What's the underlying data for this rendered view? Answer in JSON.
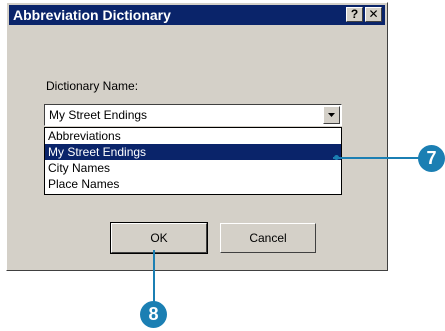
{
  "window": {
    "title": "Abbreviation Dictionary",
    "help_label": "?",
    "close_label": "✕"
  },
  "form": {
    "dictionary_label": "Dictionary Name:",
    "dictionary_value": "My Street Endings",
    "options": [
      {
        "label": "Abbreviations",
        "selected": false
      },
      {
        "label": "My Street Endings",
        "selected": true
      },
      {
        "label": "City Names",
        "selected": false
      },
      {
        "label": "Place Names",
        "selected": false
      }
    ]
  },
  "buttons": {
    "ok": "OK",
    "cancel": "Cancel"
  },
  "callouts": {
    "step_7": "7",
    "step_8": "8"
  },
  "colors": {
    "titlebar": "#0a246a",
    "dialog_face": "#d4d0c8",
    "selection": "#0a246a",
    "callout": "#1b7fb3"
  }
}
